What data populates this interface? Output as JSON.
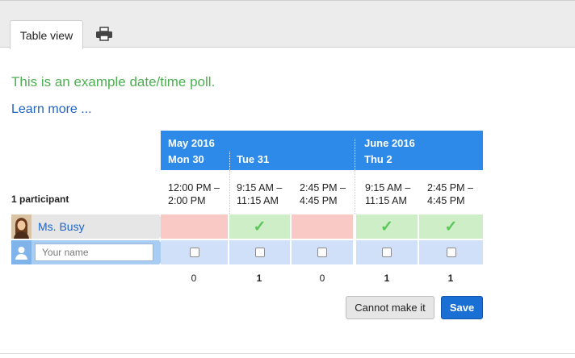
{
  "tabs": {
    "table_view": "Table view"
  },
  "intro": "This is an example date/time poll.",
  "learn_more": "Learn more ...",
  "months": [
    "May 2016",
    "June 2016"
  ],
  "days": [
    "Mon 30",
    "Tue 31",
    "Thu 2"
  ],
  "slots": [
    {
      "start": "12:00 PM –",
      "end": "2:00 PM"
    },
    {
      "start": "9:15 AM –",
      "end": "11:15 AM"
    },
    {
      "start": "2:45 PM –",
      "end": "4:45 PM"
    },
    {
      "start": "9:15 AM –",
      "end": "11:15 AM"
    },
    {
      "start": "2:45 PM –",
      "end": "4:45 PM"
    }
  ],
  "participants_label": "1 participant",
  "participant": {
    "name": "Ms. Busy",
    "votes": [
      "no",
      "yes",
      "no",
      "yes",
      "yes"
    ]
  },
  "name_input": {
    "placeholder": "Your name",
    "value": ""
  },
  "counts": [
    "0",
    "1",
    "0",
    "1",
    "1"
  ],
  "buttons": {
    "cannot": "Cannot make it",
    "save": "Save"
  },
  "colors": {
    "header": "#2d8ae8",
    "yes": "#cdeec7",
    "no": "#f8c9c5",
    "link": "#1f63c6",
    "intro": "#4caf50"
  }
}
